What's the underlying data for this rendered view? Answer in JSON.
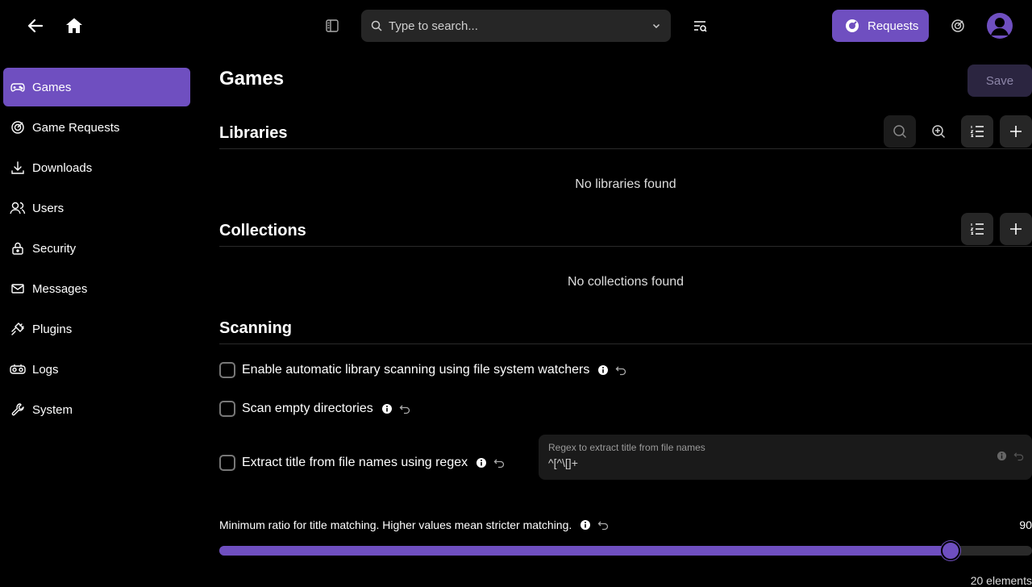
{
  "header": {
    "search_placeholder": "Type to search...",
    "requests_label": "Requests"
  },
  "sidebar": {
    "items": [
      {
        "label": "Games",
        "icon": "gamepad-icon",
        "active": true
      },
      {
        "label": "Game Requests",
        "icon": "requests-icon"
      },
      {
        "label": "Downloads",
        "icon": "download-icon"
      },
      {
        "label": "Users",
        "icon": "users-icon"
      },
      {
        "label": "Security",
        "icon": "lock-icon"
      },
      {
        "label": "Messages",
        "icon": "mail-icon"
      },
      {
        "label": "Plugins",
        "icon": "plug-icon"
      },
      {
        "label": "Logs",
        "icon": "logs-icon"
      },
      {
        "label": "System",
        "icon": "wrench-icon"
      }
    ]
  },
  "main": {
    "title": "Games",
    "save_label": "Save",
    "libraries": {
      "title": "Libraries",
      "empty": "No libraries found"
    },
    "collections": {
      "title": "Collections",
      "empty": "No collections found"
    },
    "scanning": {
      "title": "Scanning",
      "options": [
        {
          "label": "Enable automatic library scanning using file system watchers",
          "checked": false
        },
        {
          "label": "Scan empty directories",
          "checked": false
        },
        {
          "label": "Extract title from file names using regex",
          "checked": false
        }
      ],
      "regex": {
        "placeholder": "Regex to extract title from file names",
        "value": "^[^\\[]+"
      },
      "slider": {
        "label": "Minimum ratio for title matching. Higher values mean stricter matching.",
        "value": 90,
        "max": 100
      },
      "cut_text": "20 elements"
    }
  },
  "colors": {
    "accent": "#6f4fc0",
    "background": "#000000"
  }
}
